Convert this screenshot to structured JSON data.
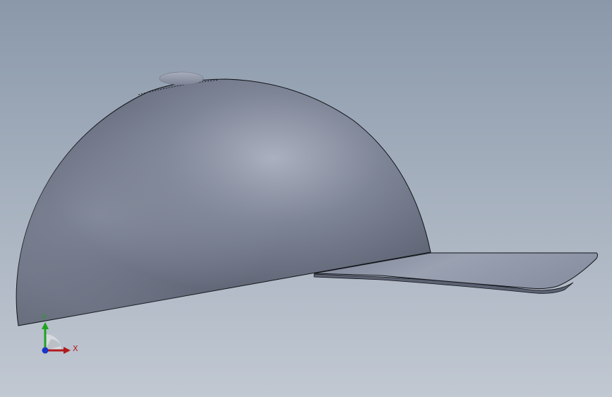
{
  "viewport": {
    "background_top": "#8a98aa",
    "background_bottom": "#c1c8d2"
  },
  "model": {
    "shape": "baseball-cap",
    "crown_color": "#6e7585",
    "brim_color": "#8a91a2",
    "button_color": "#8c93a4",
    "edge_color": "#111418"
  },
  "triad": {
    "x_label": "X",
    "y_label": "Y",
    "x_color": "#b11a1a",
    "y_color": "#1ea31e",
    "z_color": "#1a33c8"
  }
}
